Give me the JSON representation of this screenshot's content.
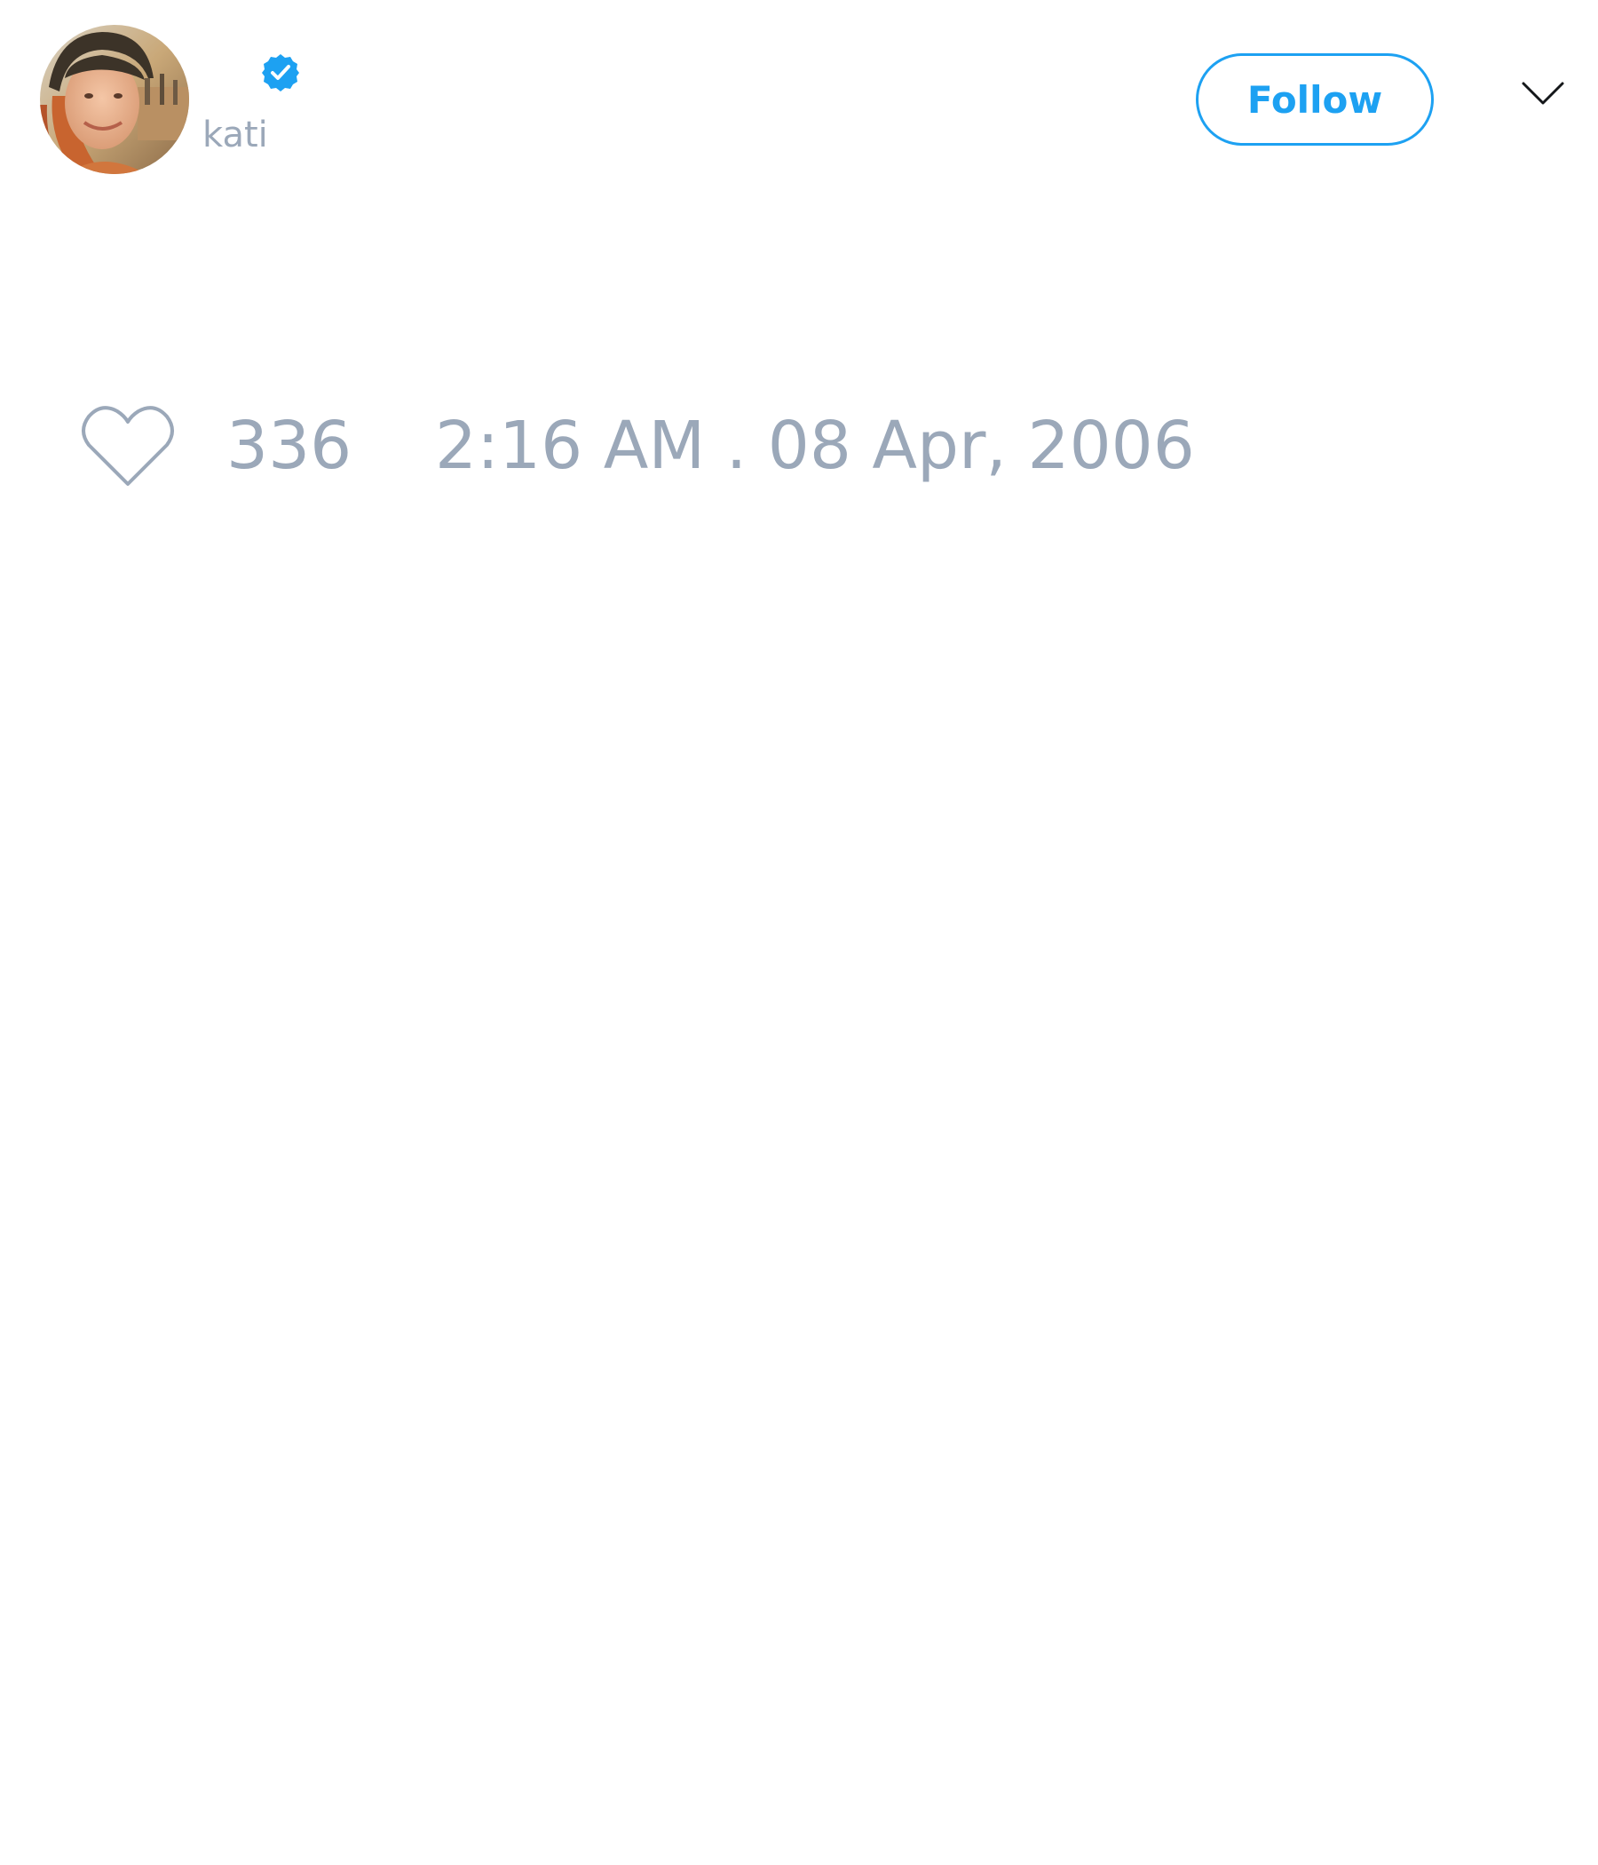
{
  "author": {
    "display_name": "",
    "handle": "kati",
    "verified": true,
    "avatar_icon": "avatar-photo",
    "verified_icon": "verified-badge-icon"
  },
  "actions": {
    "follow_label": "Follow",
    "menu_icon": "chevron-down-icon"
  },
  "engagement": {
    "like_icon": "heart-outline-icon",
    "like_count": "336"
  },
  "meta": {
    "timestamp": "2:16 AM . 08 Apr, 2006"
  },
  "colors": {
    "accent": "#1da1f2",
    "muted_text": "#9ba8b9",
    "background": "#ffffff"
  }
}
